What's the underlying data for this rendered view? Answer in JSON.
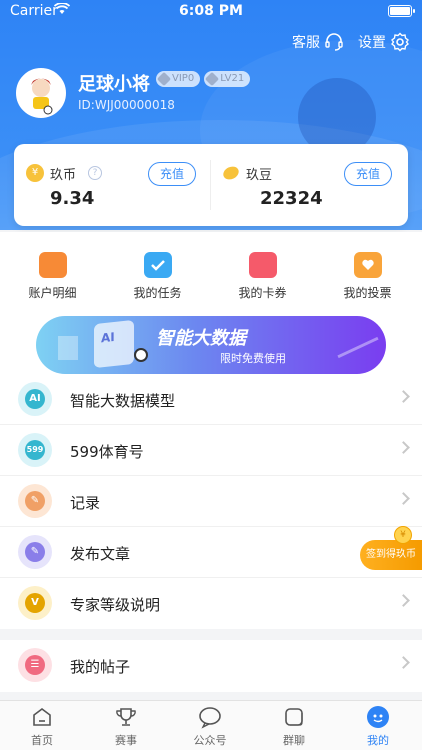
{
  "status_bar": {
    "carrier": "Carrier",
    "time": "6:08 PM"
  },
  "header": {
    "service_label": "客服",
    "settings_label": "设置",
    "username": "足球小将",
    "vip_badge": "VIP0",
    "level_badge": "LV21",
    "user_id": "ID:WJJ00000018"
  },
  "wallet": {
    "coin": {
      "label": "玖币",
      "value": "9.34",
      "button": "充值",
      "symbol": "¥"
    },
    "bean": {
      "label": "玖豆",
      "value": "22324",
      "button": "充值"
    }
  },
  "quick_actions": [
    {
      "label": "账户明细",
      "icon": "wallet-icon",
      "color": "#f78a36"
    },
    {
      "label": "我的任务",
      "icon": "task-icon",
      "color": "#3aa9f3"
    },
    {
      "label": "我的卡券",
      "icon": "coupon-icon",
      "color": "#f55a6a"
    },
    {
      "label": "我的投票",
      "icon": "vote-icon",
      "color": "#f9a43a"
    }
  ],
  "banner": {
    "icon_text": "AI",
    "title": "智能大数据",
    "subtitle": "限时免费使用"
  },
  "menu": [
    {
      "label": "智能大数据模型",
      "icon": "ai-icon",
      "icon_text": "AI",
      "bg": "#d9f3f8",
      "fg": "#34b6cf"
    },
    {
      "label": "599体育号",
      "icon": "sports-account-icon",
      "icon_text": "599",
      "bg": "#d9f3f8",
      "fg": "#34b6cf"
    },
    {
      "label": "记录",
      "icon": "record-icon",
      "icon_text": "✎",
      "bg": "#fde6d4",
      "fg": "#f0a066"
    },
    {
      "label": "发布文章",
      "icon": "article-icon",
      "icon_text": "✎",
      "bg": "#e6e4fb",
      "fg": "#8a7ee9"
    },
    {
      "label": "专家等级说明",
      "icon": "expert-level-icon",
      "icon_text": "V",
      "bg": "#fdf0c8",
      "fg": "#e4a400"
    }
  ],
  "menu2": [
    {
      "label": "我的帖子",
      "icon": "posts-icon",
      "icon_text": "☰",
      "bg": "#fde0e4",
      "fg": "#f06a80"
    }
  ],
  "checkin": {
    "label": "签到得玖币",
    "coin_symbol": "¥"
  },
  "tabs": [
    {
      "label": "首页",
      "icon": "home-icon"
    },
    {
      "label": "赛事",
      "icon": "trophy-icon"
    },
    {
      "label": "公众号",
      "icon": "official-account-icon"
    },
    {
      "label": "群聊",
      "icon": "group-chat-icon"
    },
    {
      "label": "我的",
      "icon": "profile-icon",
      "active": true
    }
  ],
  "colors": {
    "primary": "#2e83f5",
    "accent_orange": "#f59b00"
  }
}
